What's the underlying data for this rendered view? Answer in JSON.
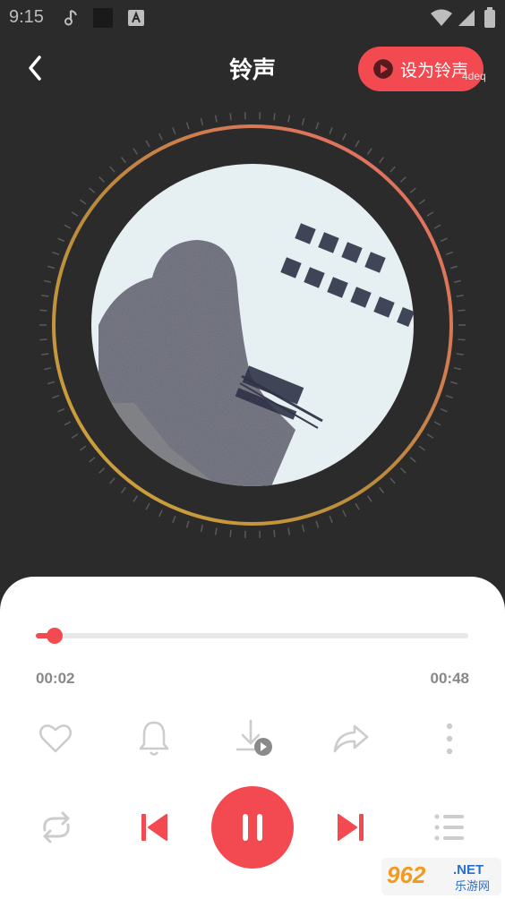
{
  "status_bar": {
    "time": "9:15"
  },
  "header": {
    "title": "铃声",
    "set_ringtone_label": "设为铃声",
    "tag": "4deq"
  },
  "player": {
    "current_time": "00:02",
    "duration": "00:48",
    "progress_fraction": 0.043
  },
  "watermark": {
    "number": "962",
    "suffix": ".NET",
    "subtext": "乐游网"
  },
  "colors": {
    "accent": "#f24a50",
    "background": "#2b2b2b",
    "sheet": "#ffffff",
    "icon_gray": "#cccccc"
  },
  "icons": {
    "actions": [
      "heart-icon",
      "bell-icon",
      "download-icon",
      "share-icon",
      "more-vertical-icon"
    ],
    "controls": [
      "repeat-icon",
      "previous-icon",
      "pause-icon",
      "next-icon",
      "playlist-icon"
    ]
  }
}
